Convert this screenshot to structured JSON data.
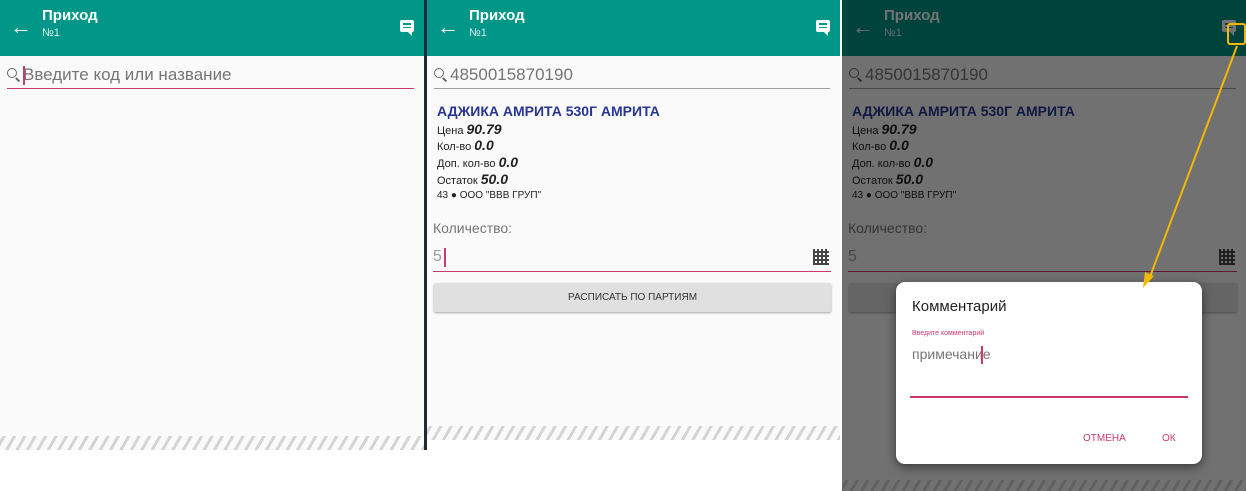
{
  "app": {
    "title": "Приход",
    "doc_number": "№1"
  },
  "search": {
    "placeholder": "Введите код или название",
    "scanned_code": "4850015870190"
  },
  "product": {
    "name": "АДЖИКА АМРИТА 530Г АМРИТА",
    "price_label": "Цена",
    "price": "90.79",
    "qty_label": "Кол-во",
    "qty": "0.0",
    "extra_qty_label": "Доп. кол-во",
    "extra_qty": "0.0",
    "stock_label": "Остаток",
    "stock": "50.0",
    "supplier": "43 ● ООО \"ВВВ ГРУП\""
  },
  "quantity": {
    "label": "Количество:",
    "value": "5"
  },
  "batch_button": "РАСПИСАТЬ ПО ПАРТИЯМ",
  "dialog": {
    "title": "Комментарий",
    "hint": "Введите комментарий",
    "value": "примечание",
    "cancel": "ОТМЕНА",
    "ok": "ОК"
  },
  "colors": {
    "appbar": "#009688",
    "accent": "#cc3a6a",
    "product_name": "#283593",
    "highlight": "#f5b700"
  },
  "icons": {
    "back": "arrow-left-icon",
    "comment": "comment-icon",
    "search": "search-icon",
    "qr": "qr-code-icon"
  }
}
